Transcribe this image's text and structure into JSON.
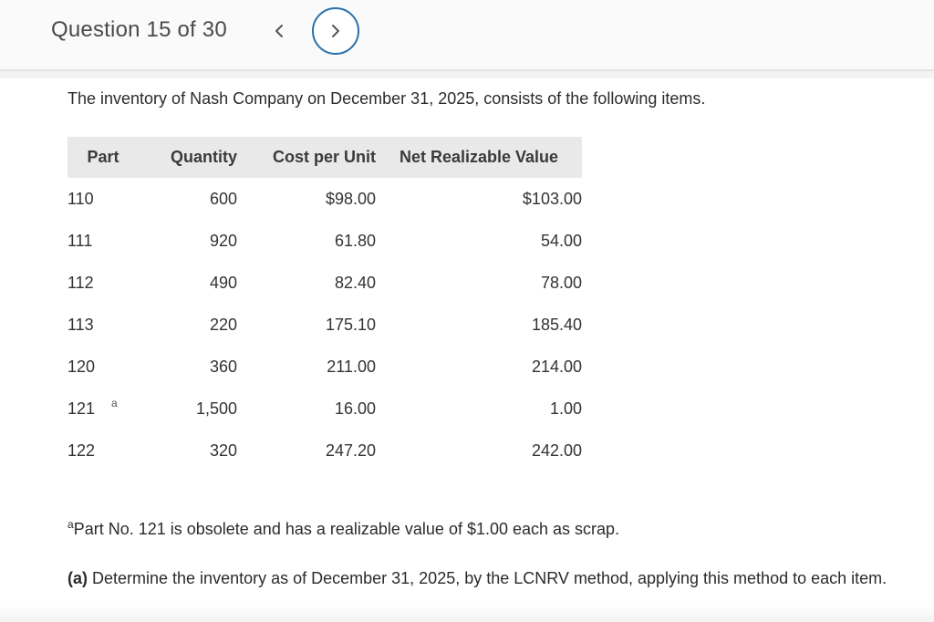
{
  "header": {
    "question_label": "Question 15 of 30",
    "prev_icon": "chevron-left-icon",
    "next_icon": "chevron-right-icon",
    "accent_color": "#2b6fa8"
  },
  "intro": "The inventory of Nash Company on December 31, 2025, consists of the following items.",
  "table": {
    "headers": [
      "Part",
      "Quantity",
      "Cost per Unit",
      "Net Realizable Value"
    ],
    "rows": [
      {
        "part": "110",
        "note": "",
        "quantity": "600",
        "cost": "$98.00",
        "nrv": "$103.00"
      },
      {
        "part": "111",
        "note": "",
        "quantity": "920",
        "cost": "61.80",
        "nrv": "54.00"
      },
      {
        "part": "112",
        "note": "",
        "quantity": "490",
        "cost": "82.40",
        "nrv": "78.00"
      },
      {
        "part": "113",
        "note": "",
        "quantity": "220",
        "cost": "175.10",
        "nrv": "185.40"
      },
      {
        "part": "120",
        "note": "",
        "quantity": "360",
        "cost": "211.00",
        "nrv": "214.00"
      },
      {
        "part": "121",
        "note": "a",
        "quantity": "1,500",
        "cost": "16.00",
        "nrv": "1.00"
      },
      {
        "part": "122",
        "note": "",
        "quantity": "320",
        "cost": "247.20",
        "nrv": "242.00"
      }
    ]
  },
  "footnote": {
    "mark": "a",
    "text": "Part No. 121 is obsolete and has a realizable value of $1.00 each as scrap."
  },
  "question_a": {
    "label": "(a)",
    "text": " Determine the inventory as of December 31, 2025, by the LCNRV method, applying this method to each item."
  }
}
